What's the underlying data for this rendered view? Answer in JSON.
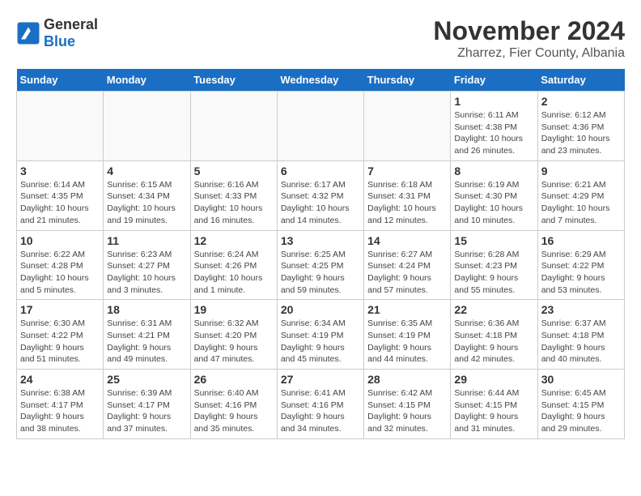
{
  "header": {
    "logo_general": "General",
    "logo_blue": "Blue",
    "month": "November 2024",
    "location": "Zharrez, Fier County, Albania"
  },
  "weekdays": [
    "Sunday",
    "Monday",
    "Tuesday",
    "Wednesday",
    "Thursday",
    "Friday",
    "Saturday"
  ],
  "weeks": [
    [
      {
        "day": "",
        "detail": ""
      },
      {
        "day": "",
        "detail": ""
      },
      {
        "day": "",
        "detail": ""
      },
      {
        "day": "",
        "detail": ""
      },
      {
        "day": "",
        "detail": ""
      },
      {
        "day": "1",
        "detail": "Sunrise: 6:11 AM\nSunset: 4:38 PM\nDaylight: 10 hours and 26 minutes."
      },
      {
        "day": "2",
        "detail": "Sunrise: 6:12 AM\nSunset: 4:36 PM\nDaylight: 10 hours and 23 minutes."
      }
    ],
    [
      {
        "day": "3",
        "detail": "Sunrise: 6:14 AM\nSunset: 4:35 PM\nDaylight: 10 hours and 21 minutes."
      },
      {
        "day": "4",
        "detail": "Sunrise: 6:15 AM\nSunset: 4:34 PM\nDaylight: 10 hours and 19 minutes."
      },
      {
        "day": "5",
        "detail": "Sunrise: 6:16 AM\nSunset: 4:33 PM\nDaylight: 10 hours and 16 minutes."
      },
      {
        "day": "6",
        "detail": "Sunrise: 6:17 AM\nSunset: 4:32 PM\nDaylight: 10 hours and 14 minutes."
      },
      {
        "day": "7",
        "detail": "Sunrise: 6:18 AM\nSunset: 4:31 PM\nDaylight: 10 hours and 12 minutes."
      },
      {
        "day": "8",
        "detail": "Sunrise: 6:19 AM\nSunset: 4:30 PM\nDaylight: 10 hours and 10 minutes."
      },
      {
        "day": "9",
        "detail": "Sunrise: 6:21 AM\nSunset: 4:29 PM\nDaylight: 10 hours and 7 minutes."
      }
    ],
    [
      {
        "day": "10",
        "detail": "Sunrise: 6:22 AM\nSunset: 4:28 PM\nDaylight: 10 hours and 5 minutes."
      },
      {
        "day": "11",
        "detail": "Sunrise: 6:23 AM\nSunset: 4:27 PM\nDaylight: 10 hours and 3 minutes."
      },
      {
        "day": "12",
        "detail": "Sunrise: 6:24 AM\nSunset: 4:26 PM\nDaylight: 10 hours and 1 minute."
      },
      {
        "day": "13",
        "detail": "Sunrise: 6:25 AM\nSunset: 4:25 PM\nDaylight: 9 hours and 59 minutes."
      },
      {
        "day": "14",
        "detail": "Sunrise: 6:27 AM\nSunset: 4:24 PM\nDaylight: 9 hours and 57 minutes."
      },
      {
        "day": "15",
        "detail": "Sunrise: 6:28 AM\nSunset: 4:23 PM\nDaylight: 9 hours and 55 minutes."
      },
      {
        "day": "16",
        "detail": "Sunrise: 6:29 AM\nSunset: 4:22 PM\nDaylight: 9 hours and 53 minutes."
      }
    ],
    [
      {
        "day": "17",
        "detail": "Sunrise: 6:30 AM\nSunset: 4:22 PM\nDaylight: 9 hours and 51 minutes."
      },
      {
        "day": "18",
        "detail": "Sunrise: 6:31 AM\nSunset: 4:21 PM\nDaylight: 9 hours and 49 minutes."
      },
      {
        "day": "19",
        "detail": "Sunrise: 6:32 AM\nSunset: 4:20 PM\nDaylight: 9 hours and 47 minutes."
      },
      {
        "day": "20",
        "detail": "Sunrise: 6:34 AM\nSunset: 4:19 PM\nDaylight: 9 hours and 45 minutes."
      },
      {
        "day": "21",
        "detail": "Sunrise: 6:35 AM\nSunset: 4:19 PM\nDaylight: 9 hours and 44 minutes."
      },
      {
        "day": "22",
        "detail": "Sunrise: 6:36 AM\nSunset: 4:18 PM\nDaylight: 9 hours and 42 minutes."
      },
      {
        "day": "23",
        "detail": "Sunrise: 6:37 AM\nSunset: 4:18 PM\nDaylight: 9 hours and 40 minutes."
      }
    ],
    [
      {
        "day": "24",
        "detail": "Sunrise: 6:38 AM\nSunset: 4:17 PM\nDaylight: 9 hours and 38 minutes."
      },
      {
        "day": "25",
        "detail": "Sunrise: 6:39 AM\nSunset: 4:17 PM\nDaylight: 9 hours and 37 minutes."
      },
      {
        "day": "26",
        "detail": "Sunrise: 6:40 AM\nSunset: 4:16 PM\nDaylight: 9 hours and 35 minutes."
      },
      {
        "day": "27",
        "detail": "Sunrise: 6:41 AM\nSunset: 4:16 PM\nDaylight: 9 hours and 34 minutes."
      },
      {
        "day": "28",
        "detail": "Sunrise: 6:42 AM\nSunset: 4:15 PM\nDaylight: 9 hours and 32 minutes."
      },
      {
        "day": "29",
        "detail": "Sunrise: 6:44 AM\nSunset: 4:15 PM\nDaylight: 9 hours and 31 minutes."
      },
      {
        "day": "30",
        "detail": "Sunrise: 6:45 AM\nSunset: 4:15 PM\nDaylight: 9 hours and 29 minutes."
      }
    ]
  ]
}
